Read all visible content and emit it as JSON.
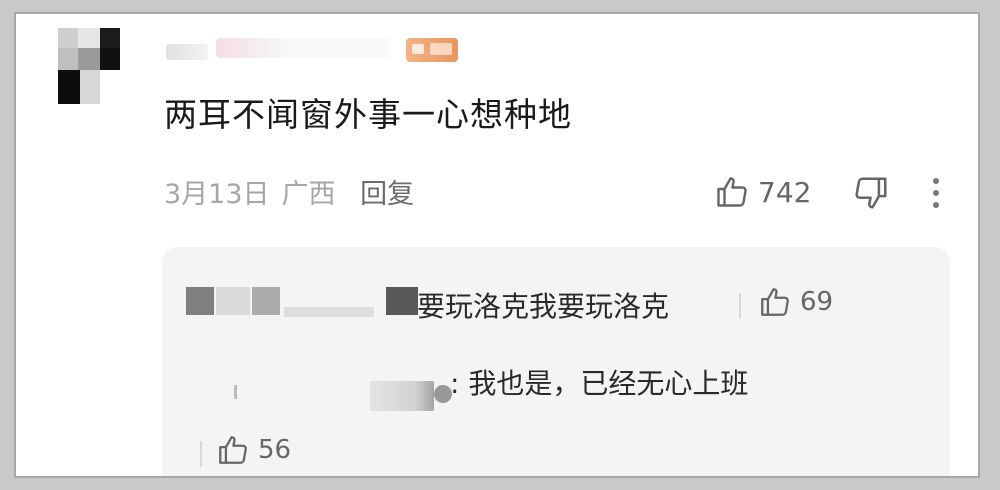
{
  "comment": {
    "text": "两耳不闻窗外事一心想种地",
    "date": "3月13日",
    "location": "广西",
    "reply_label": "回复",
    "like_count": "742"
  },
  "replies": [
    {
      "text": "要玩洛克我要玩洛克",
      "like_count": "69"
    },
    {
      "text": ": 我也是，已经无心上班",
      "like_count": "56"
    }
  ],
  "icons": {
    "like": "thumbs-up-icon",
    "dislike": "thumbs-down-icon",
    "more": "more-vertical-icon"
  },
  "colors": {
    "text_primary": "#1a1a1a",
    "text_meta": "#a6a6a6",
    "reply_bg": "#f4f4f4",
    "badge": "#ef9f6d"
  }
}
